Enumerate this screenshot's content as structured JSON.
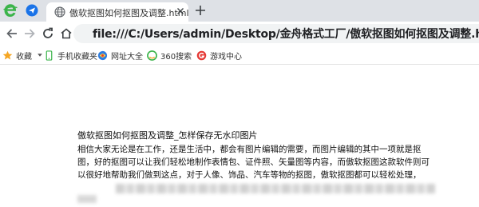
{
  "tabbar": {
    "tab_title": "傲软抠图如何抠图及调整.html",
    "icons": [
      "browser-logo-icon",
      "paper-plane-icon",
      "globe-icon",
      "close-icon",
      "plus-icon"
    ]
  },
  "toolbar": {
    "address": "file:///C:/Users/admin/Desktop/金舟格式工厂/傲软抠图如何抠图及调整.html",
    "icons": [
      "back-arrow-icon",
      "forward-arrow-icon",
      "reload-icon",
      "home-icon"
    ]
  },
  "bookmarks": {
    "items": [
      {
        "label": "收藏",
        "icon": "star-icon"
      },
      {
        "label": "手机收藏夹",
        "icon": "phone-icon"
      },
      {
        "label": "网址大全",
        "icon": "web-directory-icon"
      },
      {
        "label": "360搜索",
        "icon": "search-360-icon"
      },
      {
        "label": "游戏中心",
        "icon": "game-center-icon"
      }
    ]
  },
  "content": {
    "title": "傲软抠图如何抠图及调整_怎样保存无水印图片",
    "body": "相信大家无论是在工作，还是生活中，都会有图片编辑的需要，而图片编辑的其中一项就是抠图，好的抠图可以让我们轻松地制作表情包、证件照、矢量图等内容，而傲软抠图这款软件则可以很好地帮助我们做到这点，对于人像、饰品、汽车等物的抠图，傲软抠图都可以轻松处理，"
  },
  "colors": {
    "tabbar_bg": "#dee1e6",
    "address_bg": "#f1f3f4",
    "browser_green": "#3bb44a",
    "star_orange": "#f5a623"
  }
}
